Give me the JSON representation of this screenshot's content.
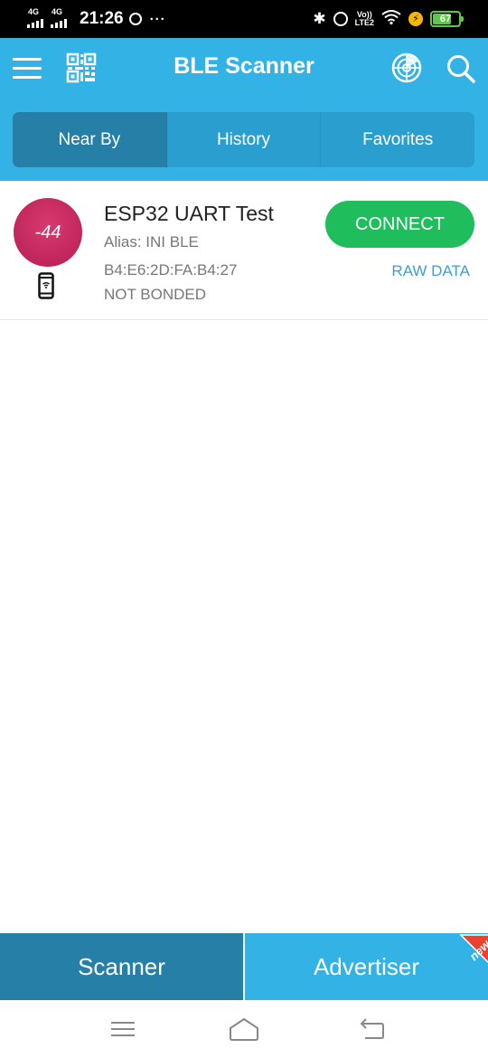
{
  "status_bar": {
    "sim1_net": "4G",
    "sim2_net": "4G",
    "time": "21:26",
    "overflow": "···",
    "volte_top": "Vo))",
    "volte_bottom": "LTE2",
    "battery": "67",
    "icons": [
      "signal-icon",
      "whatsapp-icon",
      "bluetooth-icon",
      "alarm-icon",
      "volte-icon",
      "wifi-icon",
      "charging-icon",
      "battery-icon"
    ],
    "battery_color": "#5ec84a"
  },
  "app_bar": {
    "title": "BLE Scanner",
    "icons": [
      "menu-icon",
      "qr-code-icon",
      "radar-icon",
      "search-icon"
    ],
    "color": "#33b3e5"
  },
  "tabs": [
    {
      "label": "Near By",
      "active": true
    },
    {
      "label": "History",
      "active": false
    },
    {
      "label": "Favorites",
      "active": false
    }
  ],
  "devices": [
    {
      "rssi": "-44",
      "name": "ESP32 UART Test",
      "alias": "Alias: INI BLE",
      "mac": "B4:E6:2D:FA:B4:27",
      "bond_state": "NOT BONDED",
      "connect_label": "CONNECT",
      "raw_data_label": "RAW DATA",
      "device_type_icon": "smartphone-icon"
    }
  ],
  "bottom_nav": {
    "scanner": "Scanner",
    "advertiser": "Advertiser",
    "badge": "new",
    "badge_color": "#e8432e"
  },
  "colors": {
    "accent": "#33b3e5",
    "tab_active": "#267fa6",
    "connect": "#1fbd5c",
    "rssi": "#c92a5f",
    "link": "#3a9fd6"
  },
  "system_nav": {
    "icons": [
      "recents-icon",
      "home-icon",
      "back-icon"
    ]
  }
}
